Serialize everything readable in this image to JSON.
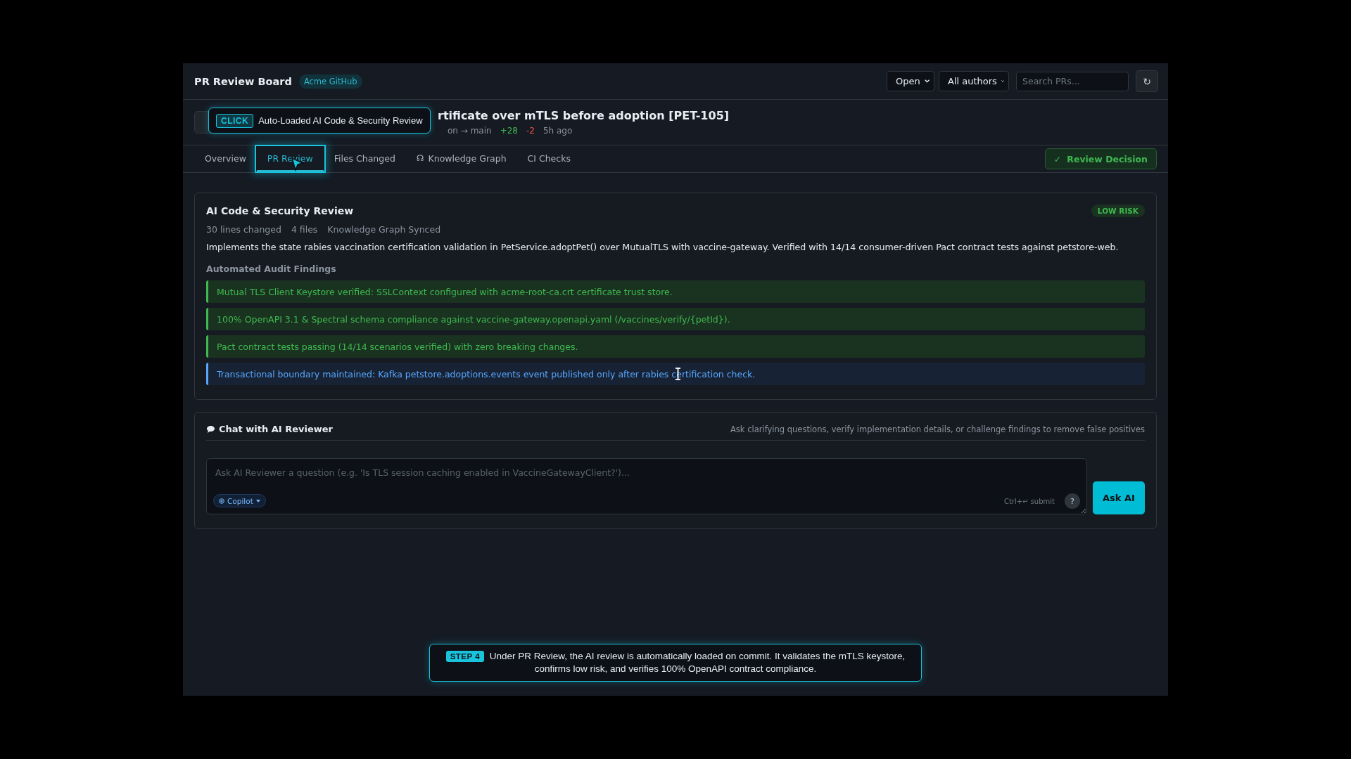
{
  "header": {
    "title": "PR Review Board",
    "badge": "Acme GitHub",
    "status_filter": "Open",
    "author_filter": "All authors",
    "search": {
      "placeholder": "Search PRs..."
    },
    "refresh": "↻"
  },
  "pr": {
    "title": "rtificate over mTLS before adoption [PET-105]",
    "branch": "on → main",
    "additions": "+28",
    "deletions": "-2",
    "age": "5h ago"
  },
  "tabs": [
    {
      "label": "Overview",
      "selected": false
    },
    {
      "label": "PR Review",
      "selected": true,
      "highlighted": true
    },
    {
      "label": "Files Changed",
      "selected": false
    },
    {
      "label": "Knowledge Graph",
      "selected": false,
      "icon": "☊"
    },
    {
      "label": "CI Checks",
      "selected": false
    }
  ],
  "review_button": {
    "icon": "✓",
    "label": "Review Decision"
  },
  "review": {
    "title": "AI Code & Security Review",
    "risk": "LOW RISK",
    "stats": [
      "30 lines changed",
      "4 files",
      "Knowledge Graph Synced"
    ],
    "summary": "Implements the state rabies vaccination certification validation in PetService.adoptPet() over MutualTLS with vaccine-gateway. Verified with 14/14 consumer-driven Pact contract tests against petstore-web.",
    "findings_heading": "Automated Audit Findings",
    "findings": [
      {
        "kind": "pass",
        "text": "Mutual TLS Client Keystore verified: SSLContext configured with acme-root-ca.crt certificate trust store."
      },
      {
        "kind": "pass",
        "text": "100% OpenAPI 3.1 & Spectral schema compliance against vaccine-gateway.openapi.yaml (/vaccines/verify/{petId})."
      },
      {
        "kind": "pass",
        "text": "Pact contract tests passing (14/14 scenarios verified) with zero breaking changes."
      },
      {
        "kind": "info",
        "text": "Transactional boundary maintained: Kafka petstore.adoptions.events event published only after rabies certification check."
      }
    ]
  },
  "chat": {
    "title": "Chat with AI Reviewer",
    "hint": "Ask clarifying questions, verify implementation details, or challenge findings to remove false positives",
    "placeholder": "Ask AI Reviewer a question (e.g. 'Is TLS session caching enabled in VaccineGatewayClient?')...",
    "model": "Copilot",
    "shortcut": "Ctrl+↵ submit",
    "help": "?",
    "submit": "Ask AI"
  },
  "callout": {
    "tag": "CLICK",
    "text": "Auto-Loaded AI Code & Security Review"
  },
  "step": {
    "tag": "STEP 4",
    "text": "Under PR Review, the AI review is automatically loaded on commit. It validates the mTLS keystore, confirms low risk, and verifies 100% OpenAPI contract compliance."
  }
}
